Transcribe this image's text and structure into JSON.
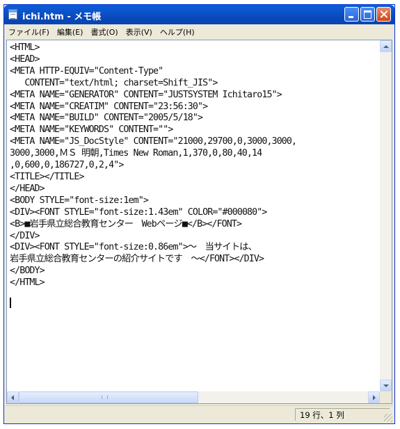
{
  "window": {
    "title": "ichi.htm - メモ帳",
    "accent_color": "#0a5fd8",
    "close_color": "#d04617",
    "icons": [
      "notepad-icon",
      "minimize-icon",
      "maximize-icon",
      "close-icon"
    ]
  },
  "menu": {
    "items": [
      {
        "label": "ファイル(F)"
      },
      {
        "label": "編集(E)"
      },
      {
        "label": "書式(O)"
      },
      {
        "label": "表示(V)"
      },
      {
        "label": "ヘルプ(H)"
      }
    ]
  },
  "editor": {
    "lines": [
      "<HTML>",
      "<HEAD>",
      "<META HTTP-EQUIV=\"Content-Type\"",
      "   CONTENT=\"text/html; charset=Shift_JIS\">",
      "<META NAME=\"GENERATOR\" CONTENT=\"JUSTSYSTEM Ichitaro15\">",
      "<META NAME=\"CREATIM\" CONTENT=\"23:56:30\">",
      "<META NAME=\"BUILD\" CONTENT=\"2005/5/18\">",
      "<META NAME=\"KEYWORDS\" CONTENT=\"\">",
      "<META NAME=\"JS_DocStyle\" CONTENT=\"21000,29700,0,3000,3000,",
      "3000,3000,ＭＳ 明朝,Times New Roman,1,370,0,80,40,14",
      ",0,600,0,186727,0,2,4\">",
      "<TITLE></TITLE>",
      "</HEAD>",
      "<BODY STYLE=\"font-size:1em\">",
      "<DIV><FONT STYLE=\"font-size:1.43em\" COLOR=\"#000080\">",
      "<B>■岩手県立総合教育センター　Webページ■</B></FONT>",
      "</DIV>",
      "<DIV><FONT STYLE=\"font-size:0.86em\">～　当サイトは、",
      "岩手県立総合教育センターの紹介サイトです　～</FONT></DIV>",
      "</BODY>",
      "</HTML>"
    ]
  },
  "status": {
    "position": "19 行、1 列"
  }
}
